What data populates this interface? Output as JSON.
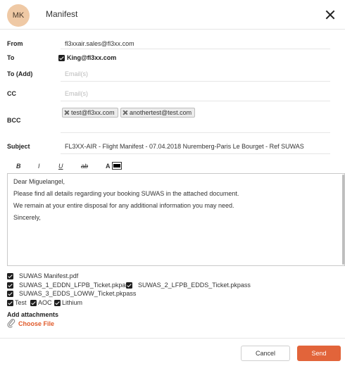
{
  "header": {
    "avatar_initials": "MK",
    "title": "Manifest"
  },
  "from": {
    "label": "From",
    "value": "fl3xxair.sales@fl3xx.com"
  },
  "to": {
    "label": "To",
    "value": "King@fl3xx.com"
  },
  "to_add": {
    "label": "To (Add)",
    "placeholder": "Email(s)"
  },
  "cc": {
    "label": "CC",
    "placeholder": "Email(s)"
  },
  "bcc": {
    "label": "BCC",
    "chips": [
      "test@fl3xx.com",
      "anothertest@test.com"
    ]
  },
  "subject": {
    "label": "Subject",
    "value": "FL3XX-AIR - Flight Manifest -  07.04.2018 Nuremberg-Paris Le Bourget - Ref SUWAS"
  },
  "toolbar": {
    "bold": "B",
    "italic": "I",
    "underline": "U",
    "strike": "ab",
    "font_color": "A"
  },
  "body_lines": [
    "Dear Miguelangel,",
    "Please find all details regarding your booking SUWAS in the attached document.",
    "We remain at your entire disposal for any additional information you may need.",
    "Sincerely,"
  ],
  "attachments": [
    "SUWAS Manifest.pdf",
    "SUWAS_1_EDDN_LFPB_Ticket.pkpass",
    "SUWAS_2_LFPB_EDDS_Ticket.pkpass",
    "SUWAS_3_EDDS_LOWW_Ticket.pkpass"
  ],
  "options": [
    "Test",
    "AOC",
    "Lithium"
  ],
  "add_attachments": {
    "label": "Add attachments",
    "choose_file": "Choose File"
  },
  "footer": {
    "cancel": "Cancel",
    "send": "Send"
  },
  "colors": {
    "accent": "#e2643a",
    "link": "#e05a2a",
    "avatar_bg": "#efc9a5"
  }
}
